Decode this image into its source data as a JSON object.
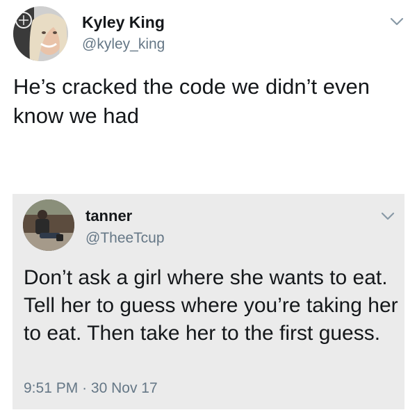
{
  "tweet": {
    "author_name": "Kyley King",
    "author_handle": "@kyley_king",
    "text": "He’s cracked the code we didn’t even know we had",
    "menu_icon": "chevron-down-icon"
  },
  "quoted_tweet": {
    "author_name": "tanner",
    "author_handle": "@TheeTcup",
    "text": "Don’t ask a girl where she wants to eat. Tell her to guess where you’re taking her to eat. Then take her to the first guess.",
    "time": "9:51 PM",
    "separator": "·",
    "date": "30 Nov 17",
    "menu_icon": "chevron-down-icon"
  },
  "colors": {
    "text_primary": "#14171a",
    "text_secondary": "#657786",
    "quote_background": "#ebebeb",
    "chevron": "#8899a6"
  }
}
